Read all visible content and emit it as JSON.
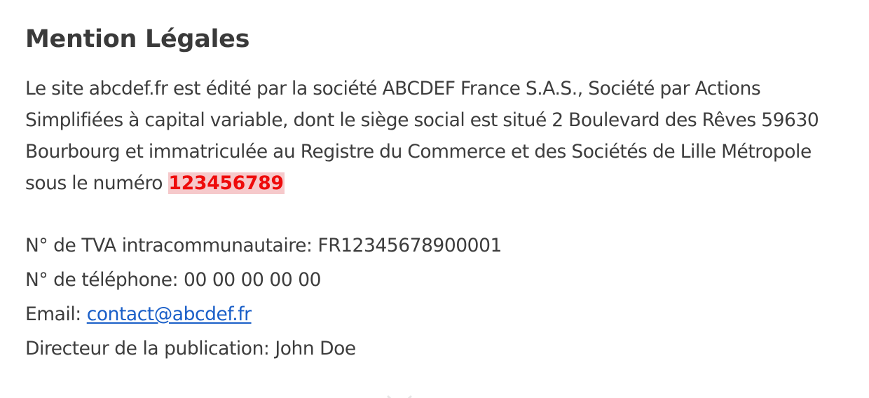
{
  "title": "Mention Légales",
  "intro": {
    "text": "Le site abcdef.fr est édité par la société ABCDEF France S.A.S., Société par Actions Simplifiées à capital variable, dont le siège social est situé 2 Boulevard des Rêves 59630 Bourbourg et immatriculée au Registre du Commerce et des Sociétés de Lille Métropole sous le numéro ",
    "registration_number": "123456789"
  },
  "info": {
    "vat": "N° de TVA intracommunautaire: FR12345678900001",
    "phone": "N° de téléphone: 00 00 00 00 00",
    "email_label": "Email: ",
    "email": "contact@abcdef.fr",
    "director": "Directeur de la publication: John Doe"
  },
  "colors": {
    "text": "#3d3d3d",
    "highlight_text": "#ee0b0b",
    "highlight_background": "#f6c9cb",
    "link": "#1a5fc8"
  }
}
